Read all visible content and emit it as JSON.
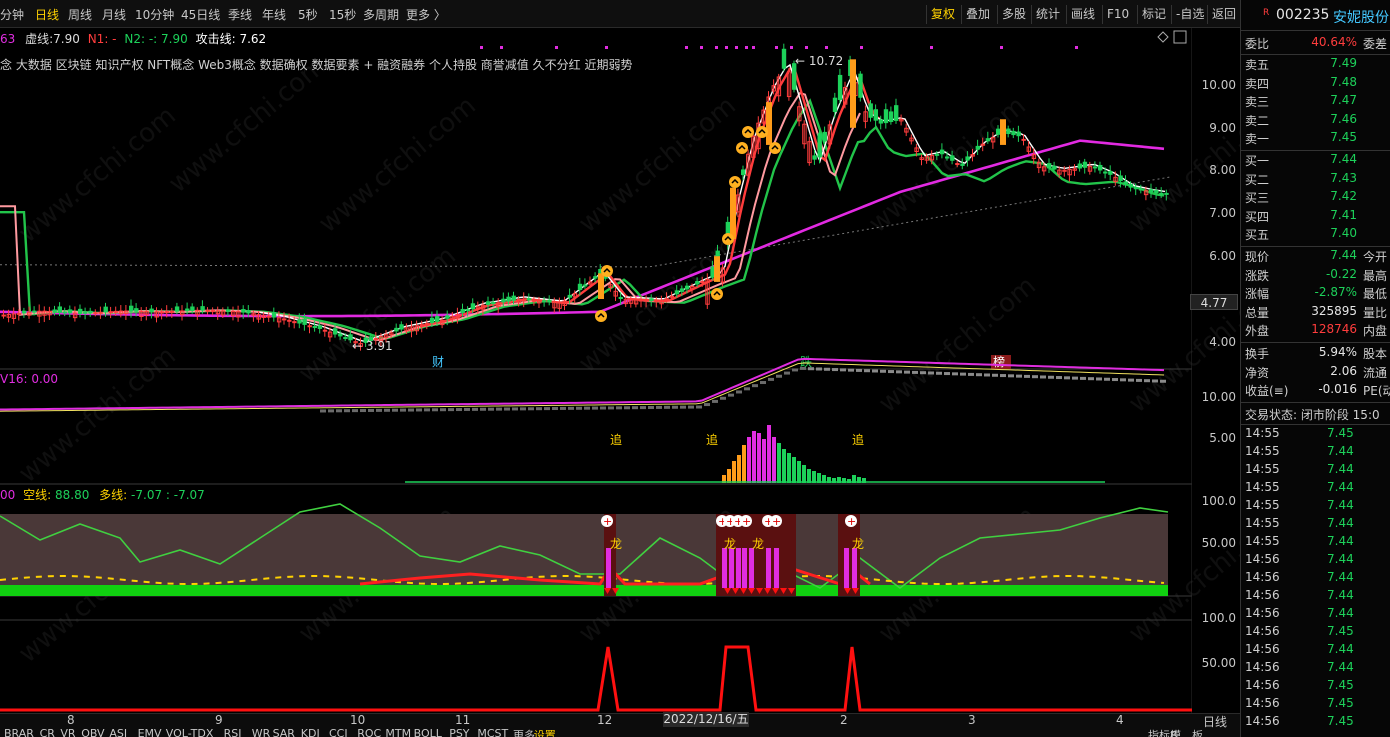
{
  "toolbar": {
    "periods": [
      "分钟",
      "日线",
      "周线",
      "月线",
      "10分钟",
      "45日线",
      "季线",
      "年线",
      "5秒",
      "15秒",
      "多周期",
      "更多 〉"
    ],
    "active_period": "日线",
    "buttons": [
      "复权",
      "叠加",
      "多股",
      "统计",
      "画线",
      "F10",
      "标记",
      "-自选",
      "返回"
    ],
    "active_button": "复权"
  },
  "indicator_line": {
    "prefix": "63",
    "xu_label": "虚线:",
    "xu_value": "7.90",
    "n1_label": "N1: -",
    "n2_label": "N2: -",
    "n2_value": ": 7.90",
    "attack_label": "攻击线:",
    "attack_value": "7.62"
  },
  "concepts": "念 大数据 区块链 知识产权 NFT概念 Web3概念 数据确权 数据要素 + 融资融券 个人持股 商誉减值 久不分红 近期弱势",
  "main_axis": [
    "10.00",
    "9.00",
    "8.00",
    "7.00",
    "6.00",
    "5.00",
    "4.00"
  ],
  "price_tag": "4.77",
  "high_label": "10.72",
  "low_label": "3.91",
  "event_labels": [
    "财",
    "跌",
    "榜"
  ],
  "pane2": {
    "label": "V16: 0.00",
    "axis": [
      "10.00",
      "5.00"
    ],
    "markers": [
      "追",
      "追",
      "追"
    ]
  },
  "pane3": {
    "label_prefix": "00",
    "kong_label": "空线:",
    "kong_value": "88.80",
    "duo_label": "多线:",
    "duo_value": "-7.07 : -7.07",
    "axis": [
      "100.0",
      "50.00"
    ],
    "markers": [
      "龙",
      "龙",
      "龙",
      "龙"
    ]
  },
  "pane4": {
    "axis": [
      "100.0",
      "50.00"
    ]
  },
  "dates": [
    "8",
    "9",
    "10",
    "11",
    "12",
    "1",
    "2",
    "3",
    "4"
  ],
  "date_cursor": "2022/12/16/五",
  "bottom_period": "日线",
  "indicator_tabs": [
    "BRAR",
    "CR",
    "VR",
    "OBV",
    "ASI",
    "EMV",
    "VOL-TDX",
    "RSI",
    "WR",
    "SAR",
    "KDJ",
    "CCI",
    "ROC",
    "MTM",
    "BOLL",
    "PSY",
    "MCST",
    "更多",
    "设置"
  ],
  "indicator_tabs_right": [
    "指标B",
    "模",
    "板"
  ],
  "quote": {
    "flag": "R",
    "code": "002235",
    "name": "安妮股份",
    "webi_label": "委比",
    "webi_value": "40.64%",
    "webi_right": "委差",
    "asks": [
      {
        "label": "卖五",
        "price": "7.49"
      },
      {
        "label": "卖四",
        "price": "7.48"
      },
      {
        "label": "卖三",
        "price": "7.47"
      },
      {
        "label": "卖二",
        "price": "7.46"
      },
      {
        "label": "卖一",
        "price": "7.45"
      }
    ],
    "bids": [
      {
        "label": "买一",
        "price": "7.44"
      },
      {
        "label": "买二",
        "price": "7.43"
      },
      {
        "label": "买三",
        "price": "7.42"
      },
      {
        "label": "买四",
        "price": "7.41"
      },
      {
        "label": "买五",
        "price": "7.40"
      }
    ],
    "stats": [
      {
        "label": "现价",
        "value": "7.44",
        "color": "#1dd15a",
        "right": "今开"
      },
      {
        "label": "涨跌",
        "value": "-0.22",
        "color": "#1dd15a",
        "right": "最高"
      },
      {
        "label": "涨幅",
        "value": "-2.87%",
        "color": "#1dd15a",
        "right": "最低"
      },
      {
        "label": "总量",
        "value": "325895",
        "color": "#e6e6e6",
        "right": "量比"
      },
      {
        "label": "外盘",
        "value": "128746",
        "color": "#ff3d3d",
        "right": "内盘"
      }
    ],
    "stats2": [
      {
        "label": "换手",
        "value": "5.94%",
        "color": "#e6e6e6",
        "right": "股本"
      },
      {
        "label": "净资",
        "value": "2.06",
        "color": "#e6e6e6",
        "right": "流通"
      },
      {
        "label": "收益(≡)",
        "value": "-0.016",
        "color": "#e6e6e6",
        "right": "PE(动"
      }
    ],
    "trade_state": "交易状态: 闭市阶段 15:0",
    "ticks": [
      {
        "t": "14:55",
        "p": "7.45"
      },
      {
        "t": "14:55",
        "p": "7.44"
      },
      {
        "t": "14:55",
        "p": "7.44"
      },
      {
        "t": "14:55",
        "p": "7.44"
      },
      {
        "t": "14:55",
        "p": "7.44"
      },
      {
        "t": "14:55",
        "p": "7.44"
      },
      {
        "t": "14:55",
        "p": "7.44"
      },
      {
        "t": "14:56",
        "p": "7.44"
      },
      {
        "t": "14:56",
        "p": "7.44"
      },
      {
        "t": "14:56",
        "p": "7.44"
      },
      {
        "t": "14:56",
        "p": "7.44"
      },
      {
        "t": "14:56",
        "p": "7.45"
      },
      {
        "t": "14:56",
        "p": "7.44"
      },
      {
        "t": "14:56",
        "p": "7.44"
      },
      {
        "t": "14:56",
        "p": "7.45"
      },
      {
        "t": "14:56",
        "p": "7.45"
      },
      {
        "t": "14:56",
        "p": "7.45"
      }
    ]
  },
  "watermark": "www.cfchi.com",
  "colors": {
    "up": "#ff3d3d",
    "down": "#1dd15a",
    "magenta": "#e02de0",
    "gold": "#ffd200",
    "ma5": "#ffffff",
    "ma10": "#ff3c3c",
    "ma20": "#ff9aa0",
    "ma30": "#22c44a",
    "ma60": "#e22ae2"
  }
}
